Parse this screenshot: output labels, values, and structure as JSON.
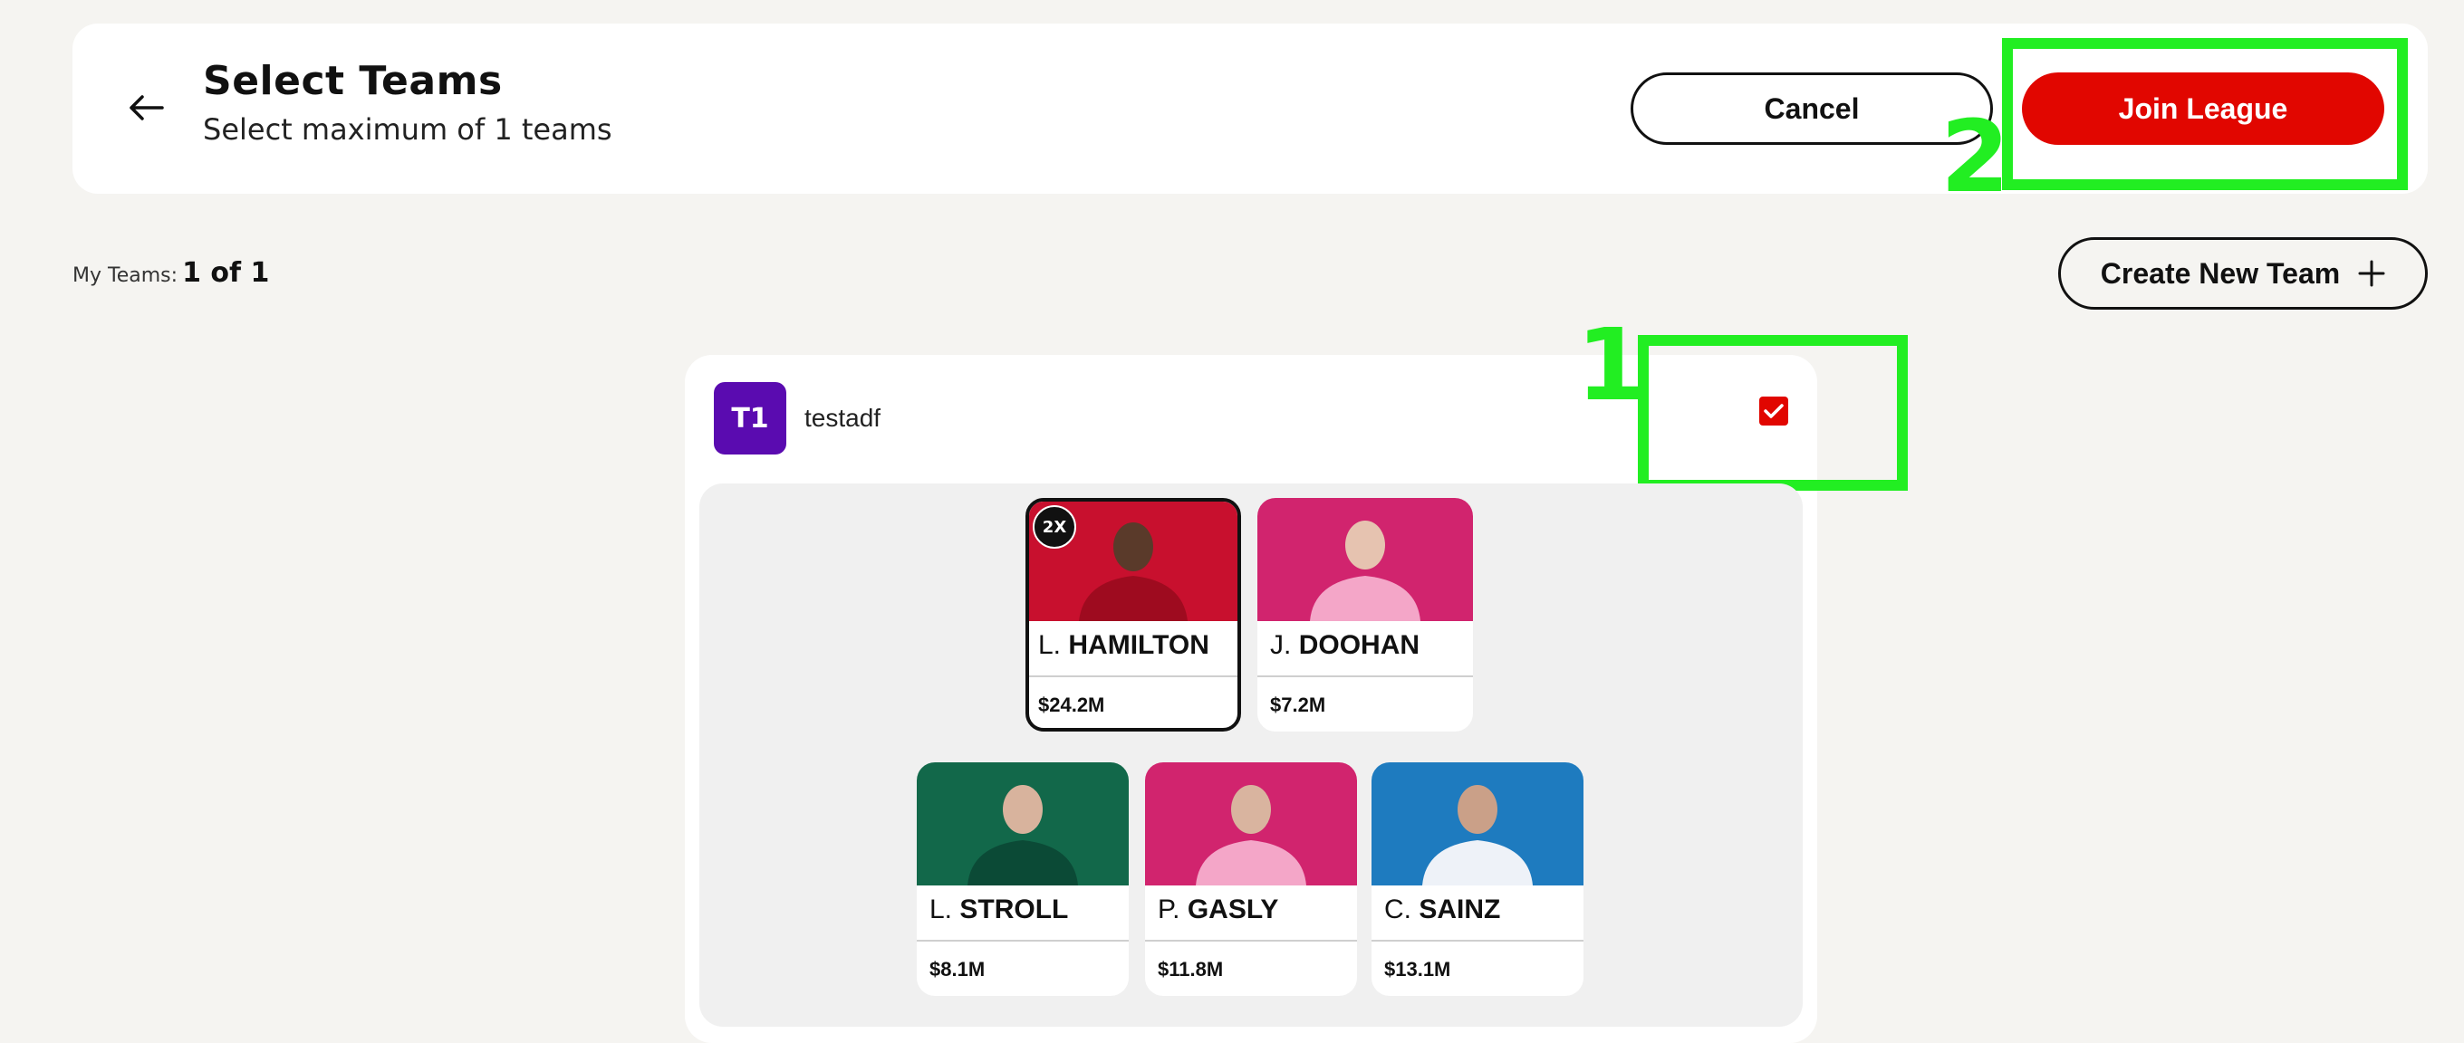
{
  "header": {
    "title": "Select Teams",
    "subtitle": "Select maximum of 1 teams",
    "cancel_label": "Cancel",
    "join_label": "Join League"
  },
  "annotations": {
    "first": "1",
    "second": "2"
  },
  "my_teams": {
    "label": "My Teams:",
    "value": "1 of 1"
  },
  "create_label": "Create New Team",
  "team": {
    "badge": "T1",
    "name": "testadf",
    "selected": true,
    "drivers": [
      {
        "initial": "L.",
        "surname": "HAMILTON",
        "price": "$24.2M",
        "chip": "2X",
        "color": "#c8102e"
      },
      {
        "initial": "J.",
        "surname": "DOOHAN",
        "price": "$7.2M",
        "color": "#d1246e"
      },
      {
        "initial": "L.",
        "surname": "STROLL",
        "price": "$8.1M",
        "color": "#12684a"
      },
      {
        "initial": "P.",
        "surname": "GASLY",
        "price": "$11.8M",
        "color": "#d1246e"
      },
      {
        "initial": "C.",
        "surname": "SAINZ",
        "price": "$13.1M",
        "color": "#1e7bbf"
      }
    ]
  },
  "colors": {
    "accent": "#e10600",
    "annotation": "#22ee22",
    "team_badge": "#5a0bb0"
  }
}
